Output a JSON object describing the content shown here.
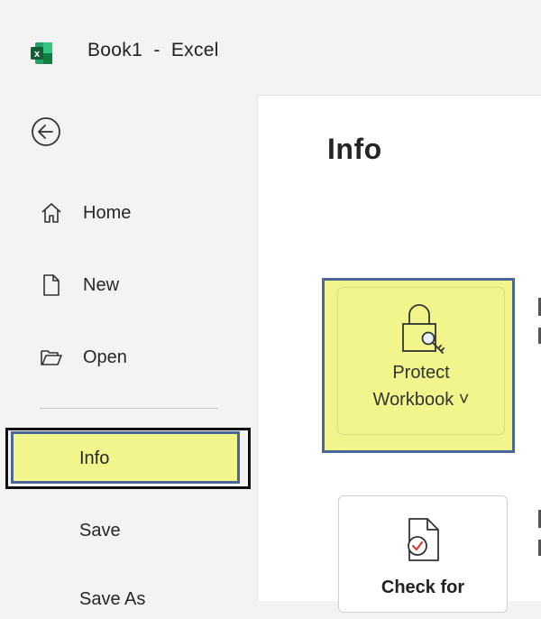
{
  "window": {
    "title": "Book1  -  Excel",
    "app_icon": "excel-icon"
  },
  "sidebar": {
    "back_icon": "back-arrow-icon",
    "items": [
      {
        "label": "Home",
        "icon": "home-icon"
      },
      {
        "label": "New",
        "icon": "new-document-icon"
      },
      {
        "label": "Open",
        "icon": "folder-open-icon"
      },
      {
        "label": "Info",
        "selected": true
      },
      {
        "label": "Save"
      },
      {
        "label": "Save As"
      }
    ]
  },
  "main": {
    "title": "Info",
    "protect_workbook": {
      "label_line1": "Protect",
      "label_line2": "Workbook ˅",
      "icon": "lock-key-icon"
    },
    "check_for_issues": {
      "label": "Check for",
      "icon": "inspect-document-icon"
    }
  },
  "colors": {
    "highlight": "#f2f48c",
    "highlight_border": "#4a6797",
    "excel_green": "#1e7145"
  }
}
